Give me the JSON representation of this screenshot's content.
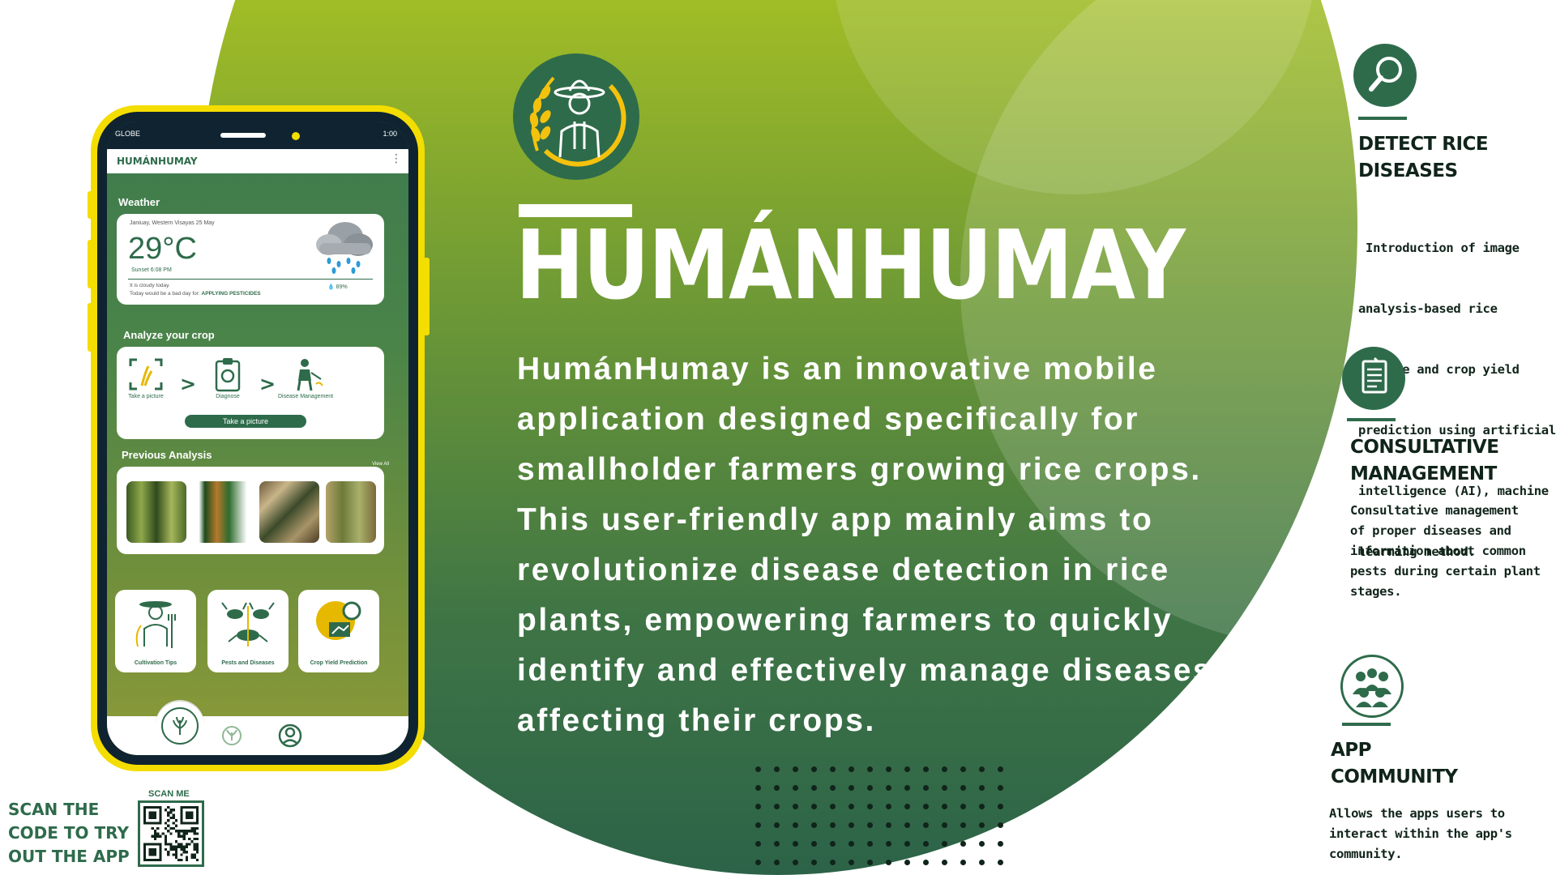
{
  "brand": {
    "app_title": "HUMÁNHUMAY",
    "description": "HumánHumay is an innovative mobile application designed specifically for smallholder farmers growing rice crops. This user-friendly app mainly aims to revolutionize disease detection in rice plants, empowering farmers to quickly identify and effectively manage diseases affecting their crops."
  },
  "colors": {
    "primary": "#2e6b4b",
    "accent_yellow": "#f4dd00",
    "dark_text": "#10241a"
  },
  "phone": {
    "status_left": "GLOBE",
    "status_right": "1:00",
    "app_bar_brand": "HUMÁNHUMAY",
    "weather": {
      "section_label": "Weather",
      "location_date": "Janiuay, Western Visayas 25 May",
      "temperature": "29°C",
      "sunset": "Sunset 6:08 PM",
      "cloudy": "It is cloudy today.",
      "bad_day_prefix": "Today would be a bad day for:",
      "bad_day_activity": "APPLYING PESTICIDES",
      "humidity": "89%",
      "icon": "rain-cloud-icon"
    },
    "analyze": {
      "section_label": "Analyze your crop",
      "steps": [
        "Take a picture",
        "Diagnose",
        "Disease Management"
      ],
      "button": "Take a picture"
    },
    "previous": {
      "section_label": "Previous Analysis",
      "view_all": "View All"
    },
    "tiles": [
      "Cultivation Tips",
      "Pests and Diseases",
      "Crop Yield Prediction"
    ],
    "nav_icons": [
      "plant-home-icon",
      "scan-plant-icon",
      "profile-icon"
    ]
  },
  "qr": {
    "scan_text_lines": [
      "SCAN THE",
      "CODE TO TRY",
      "OUT THE APP"
    ],
    "scan_me": "SCAN ME"
  },
  "features": [
    {
      "icon": "search-icon",
      "title_lines": [
        "DETECT RICE",
        "DISEASES"
      ],
      "desc_lines": [
        " Introduction of image",
        "analysis-based rice",
        "disease and crop yield",
        "prediction using artificial",
        "intelligence (AI), machine",
        "learning method."
      ]
    },
    {
      "icon": "document-icon",
      "title_lines": [
        "CONSULTATIVE",
        "MANAGEMENT"
      ],
      "desc_lines": [
        "Consultative management",
        "of proper diseases and",
        "information about common",
        "pests during certain plant",
        "stages."
      ]
    },
    {
      "icon": "community-icon",
      "title_lines": [
        "APP",
        "COMMUNITY"
      ],
      "desc_lines": [
        "Allows the apps users to",
        "interact within the app's",
        "community."
      ]
    }
  ]
}
